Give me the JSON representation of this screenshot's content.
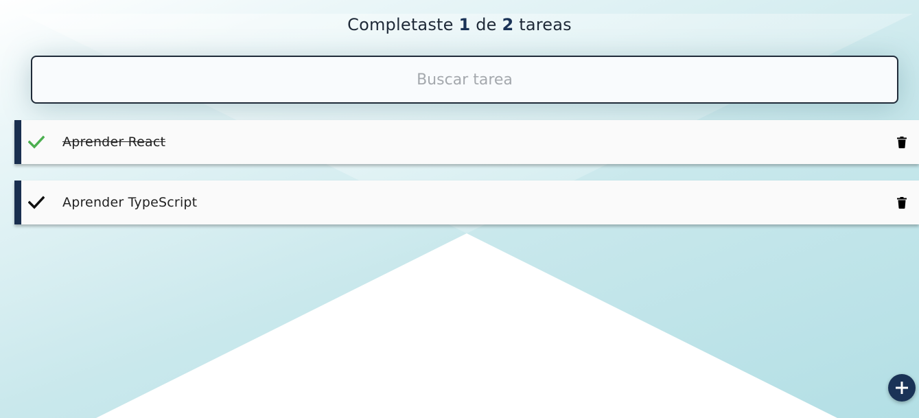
{
  "counter": {
    "prefix": "Completaste",
    "completed": "1",
    "middle": "de",
    "total": "2",
    "suffix": "tareas"
  },
  "search": {
    "placeholder": "Buscar tarea",
    "value": ""
  },
  "todos": [
    {
      "text": "Aprender React",
      "completed": true
    },
    {
      "text": "Aprender TypeScript",
      "completed": false
    }
  ],
  "icons": {
    "check": "check-icon",
    "delete": "trash-icon",
    "add": "plus-icon"
  },
  "colors": {
    "accent": "#1a3357",
    "check_done": "#4caf50",
    "check_pending": "#111111",
    "item_border": "#1a2f4f"
  }
}
